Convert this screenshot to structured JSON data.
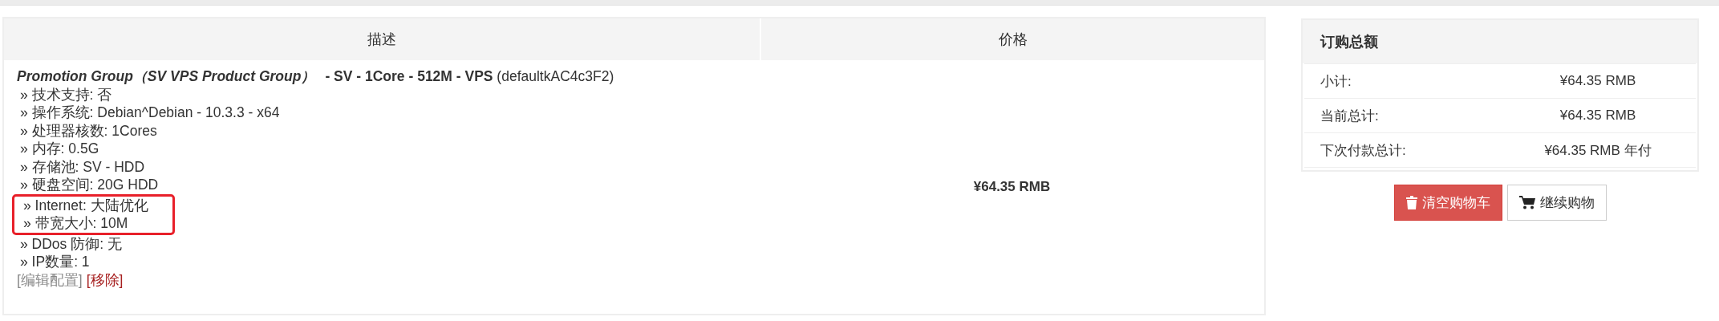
{
  "cart_table": {
    "columns": [
      "描述",
      "价格"
    ],
    "rows": [
      {
        "product_group": "Promotion Group（SV VPS Product Group）",
        "product_title": "**- SV - 1Core - 512M - VPS** (defaultkAC4c3F2)",
        "options": [
          {
            "text": "» 技术支持: 否",
            "highlighted": false
          },
          {
            "text": "» 操作系统: Debian^Debian - 10.3.3 - x64",
            "highlighted": false
          },
          {
            "text": "» 处理器核数: 1Cores",
            "highlighted": false
          },
          {
            "text": "» 内存: 0.5G",
            "highlighted": false
          },
          {
            "text": "» 存储池: SV - HDD",
            "highlighted": false
          },
          {
            "text": "» 硬盘空间: 20G HDD",
            "highlighted": false
          },
          {
            "text": "» Internet: 大陆优化",
            "highlighted": true
          },
          {
            "text": "» 带宽大小: 10M",
            "highlighted": true
          },
          {
            "text": "» DDos 防御: 无",
            "highlighted": false
          },
          {
            "text": "» IP数量: 1",
            "highlighted": false
          }
        ],
        "links": [
          {
            "text": "[编辑配置]",
            "kind": "edit"
          },
          {
            "text": "[移除]",
            "kind": "remove"
          }
        ],
        "price": "¥64.35 RMB"
      }
    ]
  },
  "order_summary": {
    "title": "订购总额",
    "rows": [
      {
        "label": "小计:",
        "value": "¥64.35 RMB"
      },
      {
        "label": "当前总计:",
        "value": "¥64.35 RMB"
      },
      {
        "label": "下次付款总计:",
        "value": "¥64.35 RMB 年付"
      }
    ]
  },
  "buttons": [
    {
      "label": "清空购物车",
      "kind": "danger"
    },
    {
      "label": "继续购物",
      "kind": "default"
    }
  ]
}
